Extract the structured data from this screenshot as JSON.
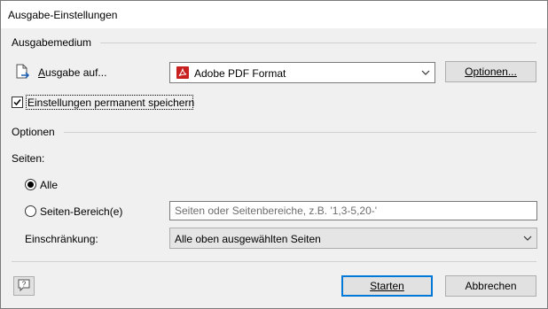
{
  "window": {
    "title": "Ausgabe-Einstellungen"
  },
  "ausgabemedium": {
    "section_label": "Ausgabemedium",
    "output_label": "Ausgabe auf...",
    "output_accesskey": "A",
    "output_icon": "document-arrow-icon",
    "printer": {
      "selected": "Adobe PDF Format",
      "icon": "adobe-pdf-icon"
    },
    "options_button": "Optionen...",
    "remember_checkbox": {
      "label": "Einstellungen permanent speichern",
      "checked": true
    }
  },
  "optionen": {
    "section_label": "Optionen",
    "pages_label": "Seiten:",
    "radio_all": {
      "label": "Alle",
      "selected": true
    },
    "radio_range": {
      "label": "Seiten-Bereich(e)",
      "selected": false
    },
    "range_input": {
      "value": "",
      "placeholder": "Seiten oder Seitenbereiche, z.B. '1,3-5,20-'"
    },
    "restriction_label": "Einschränkung:",
    "restriction_selected": "Alle oben ausgewählten Seiten"
  },
  "footer": {
    "help_icon": "help-icon",
    "start_button": "Starten",
    "cancel_button": "Abbrechen"
  },
  "colors": {
    "window_bg": "#f0f0f0",
    "accent": "#0078d7",
    "pdf_red": "#c8201f"
  }
}
